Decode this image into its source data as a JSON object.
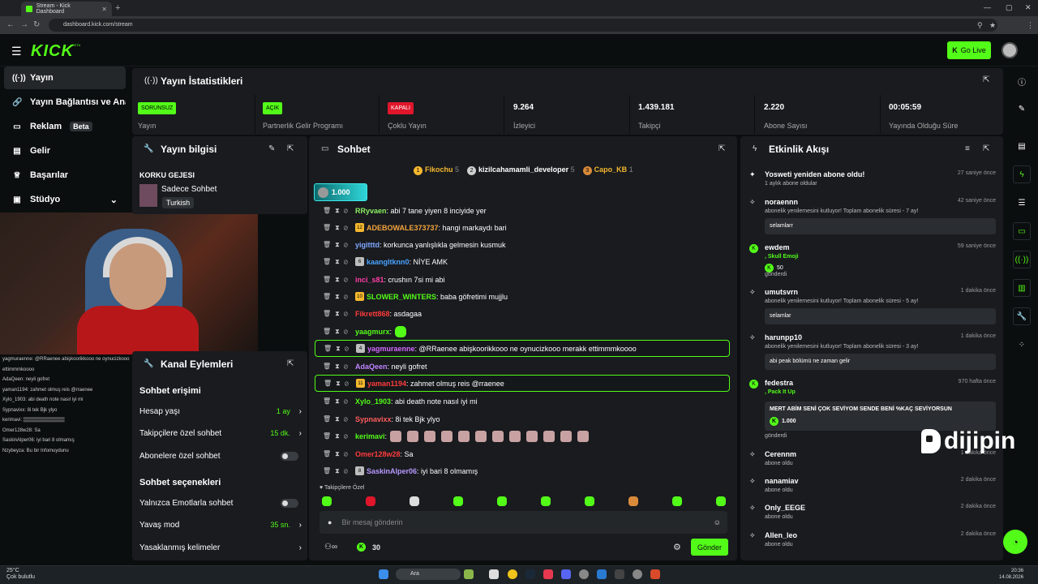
{
  "browser": {
    "tab_title": "Stream - Kick Dashboard",
    "url": "dashboard.kick.com/stream"
  },
  "header": {
    "logo": "KICK",
    "logo_badge": "BETA",
    "go_live": "Go Live"
  },
  "sidebar": {
    "items": [
      {
        "icon": "broadcast-icon",
        "label": "Yayın"
      },
      {
        "icon": "link-icon",
        "label": "Yayın Bağlantısı ve Anahtarı"
      },
      {
        "icon": "ad-icon",
        "label": "Reklam",
        "badge": "Beta"
      },
      {
        "icon": "chart-icon",
        "label": "Gelir"
      },
      {
        "icon": "trophy-icon",
        "label": "Başarılar"
      },
      {
        "icon": "studio-icon",
        "label": "Stüdyo"
      }
    ]
  },
  "overlay_chat": [
    "yagmuraenne: @RRaenee abişkoorikkooo ne oynucizkooo merakk",
    "ettimmmkoooo",
    "AdaQeen: neyli gofret",
    "yaman1194: zahmet olmuş reis @rraenee",
    "Xylo_1903: abi death note nasıl iyi mi",
    "Sypnavixx: 8i tek Bjk ylyo",
    "kerimavi: ▒▒▒▒▒▒▒▒▒▒▒▒",
    "Omer128w28: Sa",
    "SaskinAlper06: iyi bari 8 olmamış",
    "Nzybeyza: Bu bir Infomuydunu"
  ],
  "stats": {
    "title": "Yayın İstatistikleri",
    "items": [
      {
        "pill": "SORUNSUZ",
        "label": "Yayın",
        "color": "#53fc18"
      },
      {
        "pill": "AÇIK",
        "label": "Partnerlik Gelir Programı",
        "color": "#53fc18"
      },
      {
        "pill": "KAPALI",
        "label": "Çoklu Yayın",
        "color": "#e0162b"
      },
      {
        "value": "9.264",
        "label": "İzleyici"
      },
      {
        "value": "1.439.181",
        "label": "Takipçi"
      },
      {
        "value": "2.220",
        "label": "Abone Sayısı"
      },
      {
        "value": "00:05:59",
        "label": "Yayında Olduğu Süre"
      }
    ]
  },
  "info": {
    "title": "Yayın bilgisi",
    "stream_title": "KORKU GEJESI",
    "category": "Sadece Sohbet",
    "language": "Turkish"
  },
  "actions": {
    "title": "Kanal Eylemleri",
    "chat_access": "Sohbet erişimi",
    "account_age": {
      "label": "Hesap yaşı",
      "value": "1 ay"
    },
    "followers_only": {
      "label": "Takipçilere özel sohbet",
      "value": "15 dk."
    },
    "subs_only": {
      "label": "Abonelere özel sohbet"
    },
    "chat_options": "Sohbet seçenekleri",
    "emotes_only": {
      "label": "Yalnızca Emotlarla sohbet"
    },
    "slow_mode": {
      "label": "Yavaş mod",
      "value": "35 sn."
    },
    "banned_words": {
      "label": "Yasaklanmış kelimeler"
    }
  },
  "chat": {
    "title": "Sohbet",
    "top": [
      {
        "rank": "1",
        "name": "Fikochu",
        "count": "5",
        "color": "#f5b82e"
      },
      {
        "rank": "2",
        "name": "kizilcahamamli_developer",
        "count": "5",
        "color": "#cfcfcf"
      },
      {
        "rank": "3",
        "name": "Capo_KB",
        "count": "1",
        "color": "#d98a3a"
      }
    ],
    "pinned_amount": "1.000",
    "messages": [
      {
        "user": "RRyvaen",
        "color": "#8cf063",
        "text": ": abi 7 tane yiyen 8 inciyide yer"
      },
      {
        "badge": "12",
        "badge_color": "#f5b82e",
        "user": "ADEBOWALE373737",
        "color": "#f5a53d",
        "text": ": hangi markaydı bari"
      },
      {
        "user": "yigitttd",
        "color": "#7fa8ff",
        "text": ": korkunca yanlışlıkla gelmesin kusmuk"
      },
      {
        "badge": "6",
        "badge_color": "#bdbdbd",
        "user": "kaangltknn0",
        "color": "#4aa3ff",
        "text": ": NİYE AMK"
      },
      {
        "user": "inci_s81",
        "color": "#ff3fa6",
        "text": ": crushın 7si mi abi"
      },
      {
        "badge": "10",
        "badge_color": "#f5b82e",
        "user": "SLOWER_WINTERS",
        "color": "#53fc18",
        "text": ": baba göfretimi mujjlu"
      },
      {
        "user": "Fikrett868",
        "color": "#ff3b3b",
        "text": ": asdagaa"
      },
      {
        "user": "yaagmurx",
        "color": "#53fc18",
        "text": ":",
        "emote": true
      },
      {
        "badge": "4",
        "badge_color": "#bdbdbd",
        "user": "yagmuraenne",
        "color": "#d36bff",
        "text": ": @RRaenee abişkoorikkooo ne oynucizkooo merakk ettimmmkoooo",
        "highlight": true
      },
      {
        "user": "AdaQeen",
        "color": "#c084ff",
        "text": ": neyli gofret"
      },
      {
        "badge": "11",
        "badge_color": "#f5b82e",
        "user": "yaman1194",
        "color": "#ff3b3b",
        "text": ": zahmet olmuş reis @rraenee",
        "highlight": true
      },
      {
        "user": "Xylo_1903",
        "color": "#53fc18",
        "text": ": abi death note nasıl iyi mi"
      },
      {
        "user": "Sypnavixx",
        "color": "#ff5c5c",
        "text": ": 8i tek Bjk ylyo"
      },
      {
        "user": "kerimavi",
        "color": "#53fc18",
        "text": ":",
        "emotes": 12
      },
      {
        "user": "Omer128w28",
        "color": "#ff3b3b",
        "text": ": Sa"
      },
      {
        "badge": "8",
        "badge_color": "#bdbdbd",
        "user": "SaskinAlper06",
        "color": "#b799ff",
        "text": ": iyi bari 8 olmamış"
      }
    ],
    "followers_label": "Takipçilere Özel",
    "input_placeholder": "Bir mesaj gönderin",
    "points": "30",
    "send": "Gönder"
  },
  "events": {
    "title": "Etkinlik Akışı",
    "items": [
      {
        "icon": "spark-icon",
        "name": "Yosweti yeniden abone oldu!",
        "time": "27 saniye önce",
        "sub": "1 aylık abone oldular"
      },
      {
        "icon": "sub-icon",
        "name": "noraennn",
        "time": "42 saniye önce",
        "sub": "abonelik yenilemesini kutluyor! Toplam abonelik süresi - 7 ay!",
        "msg": "selamlarr"
      },
      {
        "icon": "kick-icon",
        "name": "ewdem",
        "time": "59 saniye önce",
        "sub": ", Skull Emoji",
        "amount": "50",
        "note": "gönderdi"
      },
      {
        "icon": "sub-icon",
        "name": "umutsvrn",
        "time": "1 dakika önce",
        "sub": "abonelik yenilemesini kutluyor! Toplam abonelik süresi - 5 ay!",
        "msg": "selamlar"
      },
      {
        "icon": "sub-icon",
        "name": "harunpp10",
        "time": "1 dakika önce",
        "sub": "abonelik yenilemesini kutluyor! Toplam abonelik süresi - 3 ay!",
        "msg": "abi peak bölümü ne zaman gelir"
      },
      {
        "icon": "kick-icon",
        "name": "fedestra",
        "time": "970 hafta önce",
        "sub": ", Pack It Up",
        "msg": "MERT ABİM SENİ ÇOK SEVİYOM SENDE BENİ %KAÇ SEVİYORSUN",
        "amount": "1.000",
        "note": "gönderdi"
      },
      {
        "icon": "sub-icon",
        "name": "Cerennm",
        "time": "1 dakika önce",
        "sub": "abone oldu"
      },
      {
        "icon": "sub-icon",
        "name": "nanamiav",
        "time": "2 dakika önce",
        "sub": "abone oldu"
      },
      {
        "icon": "sub-icon",
        "name": "Only_EEGE",
        "time": "2 dakika önce",
        "sub": "abone oldu"
      },
      {
        "icon": "sub-icon",
        "name": "Allen_leo",
        "time": "2 dakika önce",
        "sub": "abone oldu"
      }
    ]
  },
  "watermark": "dijipin",
  "taskbar": {
    "temp": "25°C",
    "weather": "Çok bulutlu",
    "search": "Ara",
    "time": "20:36",
    "date": "14.08.2026"
  }
}
